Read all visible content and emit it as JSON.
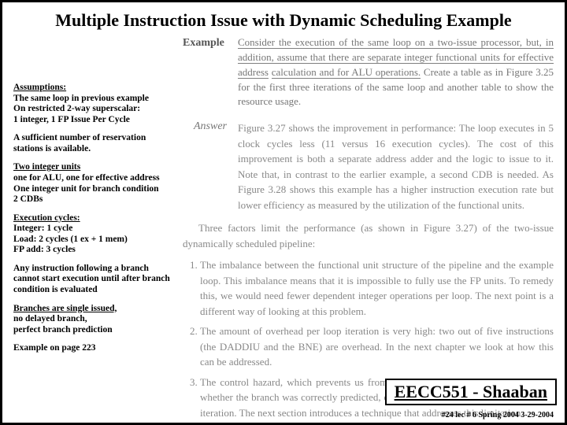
{
  "title": "Multiple Instruction Issue with Dynamic Scheduling Example",
  "example": {
    "label": "Example",
    "text_a": "Consider the execution of the same loop on a two-issue processor, but, in addition, assume that there are separate integer functional units for effective address",
    "text_b": "calculation and for ALU operations.",
    "text_c": "Create a table as in Figure 3.25 for the first three iterations of the same loop and another table to show the resource usage."
  },
  "answer": {
    "label": "Answer",
    "text": "Figure 3.27 shows the improvement in performance: The loop executes in 5 clock cycles less (11 versus 16 execution cycles). The cost of this improvement is both a separate address adder and the logic to issue to it. Note that, in contrast to the earlier example, a second CDB is needed. As Figure 3.28 shows this example has a higher instruction execution rate but lower efficiency as measured by the utilization of the functional units."
  },
  "para_intro": "Three factors limit the performance (as shown in Figure 3.27) of the two-issue dynamically scheduled pipeline:",
  "factors": [
    "The imbalance between the functional unit structure of the pipeline and the example loop. This imbalance means that it is impossible to fully use the FP units. To remedy this, we would need fewer dependent integer operations per loop. The next point is a different way of looking at this problem.",
    "The amount of overhead per loop iteration is very high: two out of five instructions (the DADDIU and the BNE) are overhead. In the next chapter we look at how this can be addressed.",
    "The control hazard, which prevents us from starting the next L.D before we know whether the branch was correctly predicted, causes a one-cycle penalty on every loop iteration. The next section introduces a technique that addresses this limitation."
  ],
  "left": {
    "assumptions_h": "Assumptions:",
    "assumptions_body": "The same loop in previous example\nOn restricted 2-way superscalar:\n1 integer, 1 FP Issue Per Cycle",
    "reservation": "A sufficient number of reservation stations is available.",
    "two_int_h": "Two integer units",
    "two_int_body": "one for ALU, one for effective address\nOne integer unit for branch condition\n2 CDBs",
    "exec_h": "Execution cycles:",
    "exec_body": "Integer: 1 cycle\nLoad: 2 cycles (1 ex + 1 mem)\nFP add: 3 cycles",
    "branch_follow": "Any instruction following a branch cannot start execution until after branch condition is evaluated",
    "single_h": "Branches are single issued,",
    "single_body": "no delayed branch,\nperfect branch prediction",
    "page_ref": "Example on page 223"
  },
  "footer": {
    "course": "EECC551 - Shaaban",
    "meta": "#24 lec # 6   Spring 2004  3-29-2004"
  }
}
